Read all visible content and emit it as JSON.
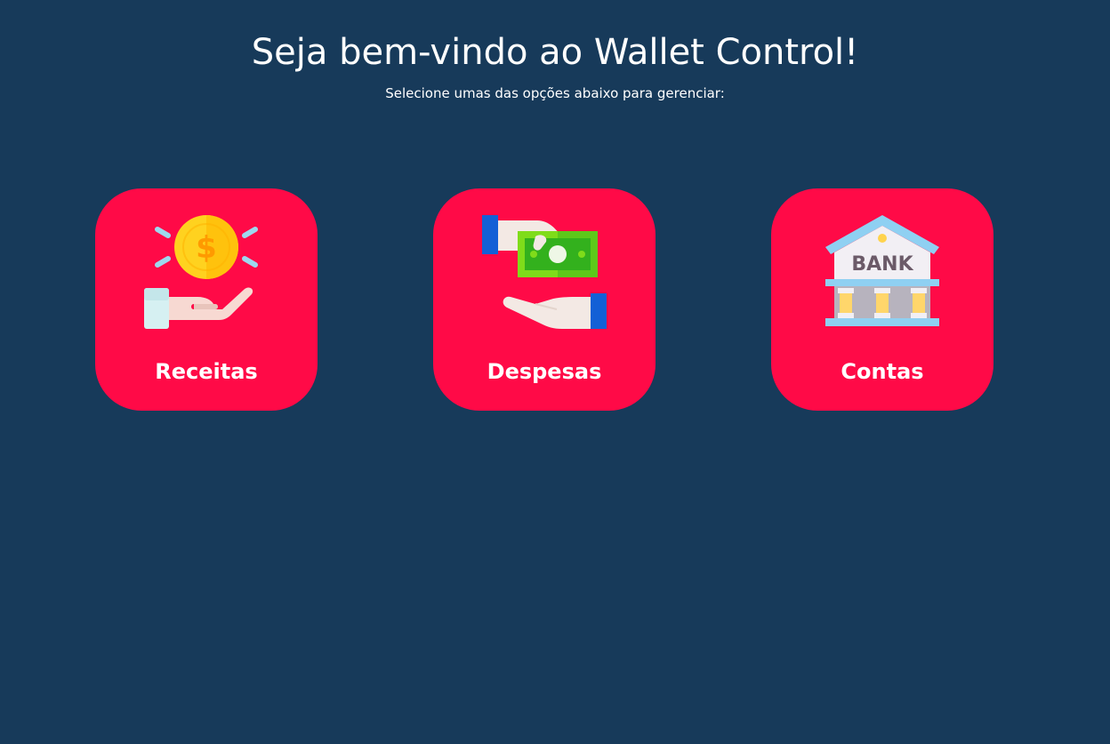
{
  "header": {
    "title": "Seja bem-vindo ao Wallet Control!",
    "subtitle": "Selecione umas das opções abaixo para gerenciar:"
  },
  "cards": [
    {
      "label": "Receitas",
      "icon": "hand-coin-icon"
    },
    {
      "label": "Despesas",
      "icon": "money-transfer-icon"
    },
    {
      "label": "Contas",
      "icon": "bank-icon",
      "icon_text": "BANK"
    }
  ],
  "colors": {
    "background": "#173a5a",
    "card": "#ff0a47",
    "text": "#ffffff"
  }
}
